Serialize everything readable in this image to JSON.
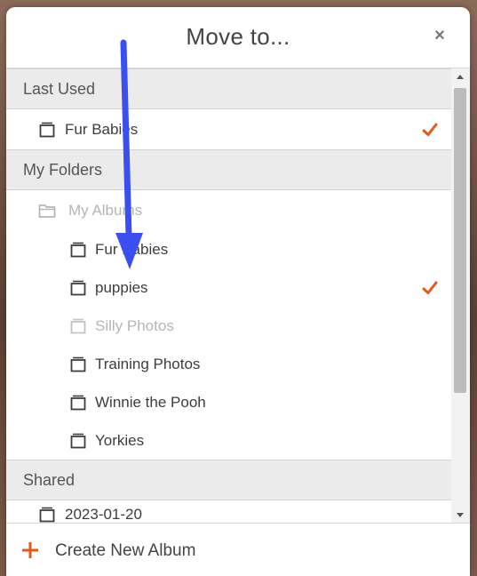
{
  "dialog": {
    "title": "Move to...",
    "close_label": "×"
  },
  "sections": {
    "last_used": {
      "header": "Last Used",
      "items": [
        {
          "label": "Fur Babies",
          "selected": true
        }
      ]
    },
    "my_folders": {
      "header": "My Folders",
      "parent_folder": {
        "label": "My Albums",
        "disabled": true
      },
      "items": [
        {
          "label": "Fur Babies",
          "selected": false,
          "disabled": false
        },
        {
          "label": "puppies",
          "selected": true,
          "disabled": false
        },
        {
          "label": "Silly Photos",
          "selected": false,
          "disabled": true
        },
        {
          "label": "Training Photos",
          "selected": false,
          "disabled": false
        },
        {
          "label": "Winnie the Pooh",
          "selected": false,
          "disabled": false
        },
        {
          "label": "Yorkies",
          "selected": false,
          "disabled": false
        }
      ]
    },
    "shared": {
      "header": "Shared",
      "items": [
        {
          "label": "2023-01-20"
        }
      ]
    }
  },
  "footer": {
    "create_label": "Create New Album"
  },
  "colors": {
    "accent": "#e05a1e",
    "annotation_arrow": "#3b4ef0",
    "section_bg": "#ebebeb"
  },
  "icons": {
    "album": "album-icon",
    "folder": "folder-icon",
    "check": "check-icon",
    "close": "close-icon",
    "plus": "plus-icon"
  }
}
